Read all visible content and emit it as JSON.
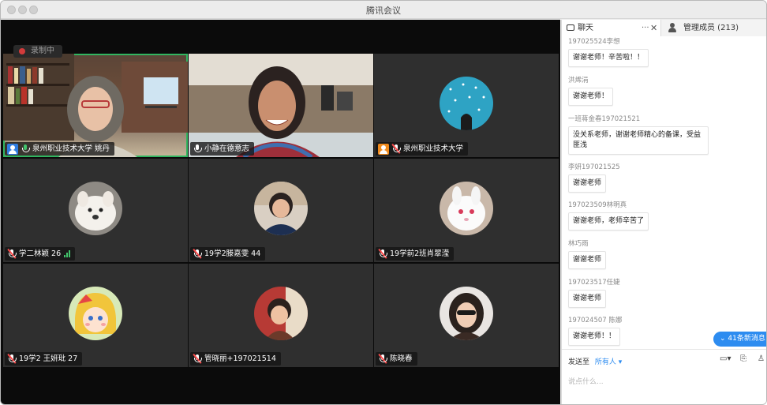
{
  "window": {
    "title": "腾讯会议"
  },
  "recording": {
    "label": "录制中"
  },
  "participants": [
    {
      "name": "泉州职业技术大学 姚丹",
      "role": "host",
      "mic": "on"
    },
    {
      "name": "小静在德意志",
      "role": "",
      "mic": "normal"
    },
    {
      "name": "泉州职业技术大学",
      "role": "cohost",
      "mic": "off"
    },
    {
      "name": "学二林颖 26",
      "role": "",
      "mic": "off",
      "volume_bars": true
    },
    {
      "name": "19学2滕嘉雯 44",
      "role": "",
      "mic": "off"
    },
    {
      "name": "19学前2班肖翠滢",
      "role": "",
      "mic": "off"
    },
    {
      "name": "19学2 王妍玭 27",
      "role": "",
      "mic": "off"
    },
    {
      "name": "管晓丽+197021514",
      "role": "",
      "mic": "off"
    },
    {
      "name": "陈晓春",
      "role": "",
      "mic": "off"
    }
  ],
  "sidebar": {
    "tabs": {
      "chat": "聊天",
      "members": "管理成员 (213)"
    },
    "messages": [
      {
        "sender": "197025524李想",
        "text": "谢谢老师！辛苦啦！！"
      },
      {
        "sender": "洪烯涓",
        "text": "谢谢老师！"
      },
      {
        "sender": "一班蒋金春197021521",
        "text": "没关系老师，谢谢老师精心的备课，受益匪浅"
      },
      {
        "sender": "李妍197021525",
        "text": "谢谢老师"
      },
      {
        "sender": "197023509林明真",
        "text": "谢谢老师，老师辛苦了"
      },
      {
        "sender": "林巧雨",
        "text": "谢谢老师"
      },
      {
        "sender": "197023517任婕",
        "text": "谢谢老师"
      },
      {
        "sender": "197024507 陈娜",
        "text": "谢谢老师！！"
      }
    ],
    "new_messages": "41条新消息",
    "send_to_label": "发送至",
    "recipient": "所有人",
    "input_placeholder": "说点什么..."
  },
  "colors": {
    "accent": "#2d8cf0",
    "active_speaker": "#31b560",
    "host_badge": "#2e7ce0",
    "cohost_badge": "#f08a1c"
  }
}
